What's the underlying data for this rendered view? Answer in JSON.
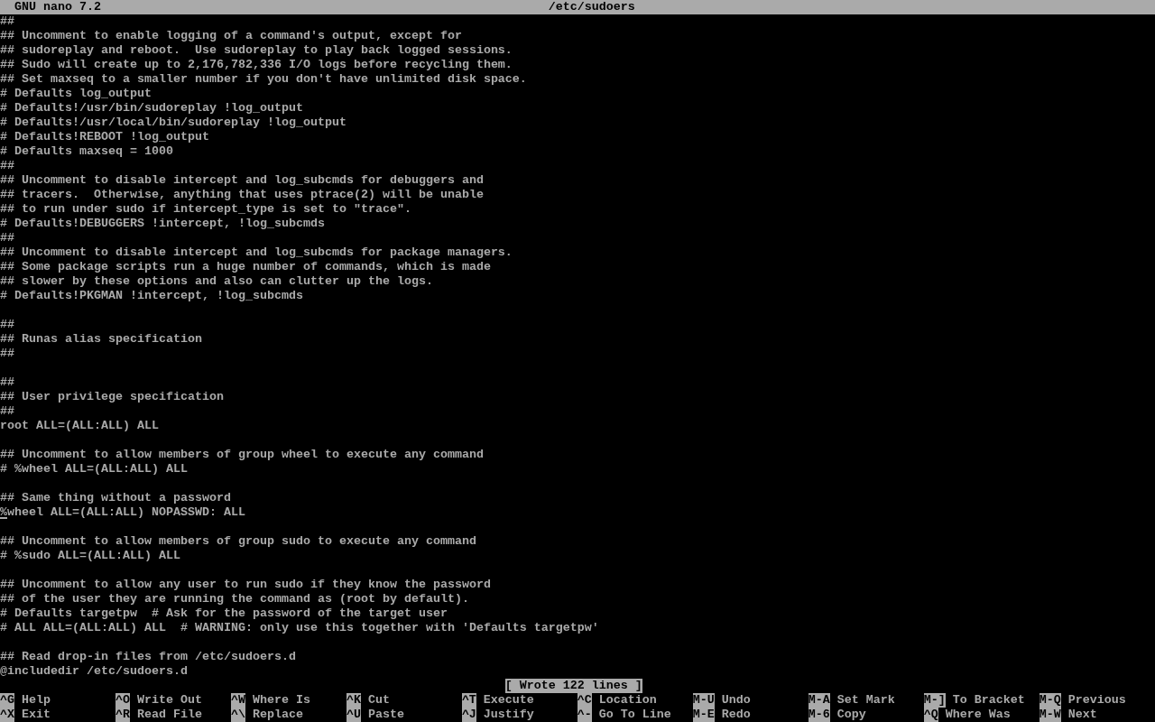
{
  "title_bar": {
    "app": "GNU nano 7.2",
    "file": "/etc/sudoers"
  },
  "editor": {
    "blocks": [
      {
        "lines": [
          {
            "text": "##",
            "cursor": false
          },
          {
            "text": "## Uncomment to enable logging of a command's output, except for",
            "cursor": false
          },
          {
            "text": "## sudoreplay and reboot.  Use sudoreplay to play back logged sessions.",
            "cursor": false
          },
          {
            "text": "## Sudo will create up to 2,176,782,336 I/O logs before recycling them.",
            "cursor": false
          },
          {
            "text": "## Set maxseq to a smaller number if you don't have unlimited disk space.",
            "cursor": false
          },
          {
            "text": "# Defaults log_output",
            "cursor": false
          },
          {
            "text": "# Defaults!/usr/bin/sudoreplay !log_output",
            "cursor": false
          },
          {
            "text": "# Defaults!/usr/local/bin/sudoreplay !log_output",
            "cursor": false
          },
          {
            "text": "# Defaults!REBOOT !log_output",
            "cursor": false
          },
          {
            "text": "# Defaults maxseq = 1000",
            "cursor": false
          },
          {
            "text": "##",
            "cursor": false
          },
          {
            "text": "## Uncomment to disable intercept and log_subcmds for debuggers and",
            "cursor": false
          },
          {
            "text": "## tracers.  Otherwise, anything that uses ptrace(2) will be unable",
            "cursor": false
          },
          {
            "text": "## to run under sudo if intercept_type is set to \"trace\".",
            "cursor": false
          },
          {
            "text": "# Defaults!DEBUGGERS !intercept, !log_subcmds",
            "cursor": false
          },
          {
            "text": "##",
            "cursor": false
          },
          {
            "text": "## Uncomment to disable intercept and log_subcmds for package managers.",
            "cursor": false
          },
          {
            "text": "## Some package scripts run a huge number of commands, which is made",
            "cursor": false
          },
          {
            "text": "## slower by these options and also can clutter up the logs.",
            "cursor": false
          },
          {
            "text": "# Defaults!PKGMAN !intercept, !log_subcmds",
            "cursor": false
          }
        ]
      },
      {
        "lines": [
          {
            "text": "##",
            "cursor": false
          },
          {
            "text": "## Runas alias specification",
            "cursor": false
          },
          {
            "text": "##",
            "cursor": false
          }
        ]
      },
      {
        "lines": [
          {
            "text": "##",
            "cursor": false
          },
          {
            "text": "## User privilege specification",
            "cursor": false
          },
          {
            "text": "##",
            "cursor": false
          },
          {
            "text": "root ALL=(ALL:ALL) ALL",
            "cursor": false
          }
        ]
      },
      {
        "lines": [
          {
            "text": "## Uncomment to allow members of group wheel to execute any command",
            "cursor": false
          },
          {
            "text": "# %wheel ALL=(ALL:ALL) ALL",
            "cursor": false
          }
        ]
      },
      {
        "lines": [
          {
            "text": "## Same thing without a password",
            "cursor": false
          },
          {
            "text": "%wheel ALL=(ALL:ALL) NOPASSWD: ALL",
            "cursor": true
          }
        ]
      },
      {
        "lines": [
          {
            "text": "## Uncomment to allow members of group sudo to execute any command",
            "cursor": false
          },
          {
            "text": "# %sudo ALL=(ALL:ALL) ALL",
            "cursor": false
          }
        ]
      },
      {
        "lines": [
          {
            "text": "## Uncomment to allow any user to run sudo if they know the password",
            "cursor": false
          },
          {
            "text": "## of the user they are running the command as (root by default).",
            "cursor": false
          },
          {
            "text": "# Defaults targetpw  # Ask for the password of the target user",
            "cursor": false
          },
          {
            "text": "# ALL ALL=(ALL:ALL) ALL  # WARNING: only use this together with 'Defaults targetpw'",
            "cursor": false
          }
        ]
      },
      {
        "lines": [
          {
            "text": "## Read drop-in files from /etc/sudoers.d",
            "cursor": false
          },
          {
            "text": "@includedir /etc/sudoers.d",
            "cursor": false
          }
        ]
      }
    ]
  },
  "status_message": "[ Wrote 122 lines ]",
  "shortcuts": [
    {
      "key": "^G",
      "label": "Help"
    },
    {
      "key": "^O",
      "label": "Write Out"
    },
    {
      "key": "^W",
      "label": "Where Is"
    },
    {
      "key": "^K",
      "label": "Cut"
    },
    {
      "key": "^T",
      "label": "Execute"
    },
    {
      "key": "^C",
      "label": "Location"
    },
    {
      "key": "M-U",
      "label": "Undo"
    },
    {
      "key": "M-A",
      "label": "Set Mark"
    },
    {
      "key": "M-]",
      "label": "To Bracket"
    },
    {
      "key": "M-Q",
      "label": "Previous"
    },
    {
      "key": "^X",
      "label": "Exit"
    },
    {
      "key": "^R",
      "label": "Read File"
    },
    {
      "key": "^\\",
      "label": "Replace"
    },
    {
      "key": "^U",
      "label": "Paste"
    },
    {
      "key": "^J",
      "label": "Justify"
    },
    {
      "key": "^-",
      "label": "Go To Line"
    },
    {
      "key": "M-E",
      "label": "Redo"
    },
    {
      "key": "M-6",
      "label": "Copy"
    },
    {
      "key": "^Q",
      "label": "Where Was"
    },
    {
      "key": "M-W",
      "label": "Next"
    }
  ]
}
